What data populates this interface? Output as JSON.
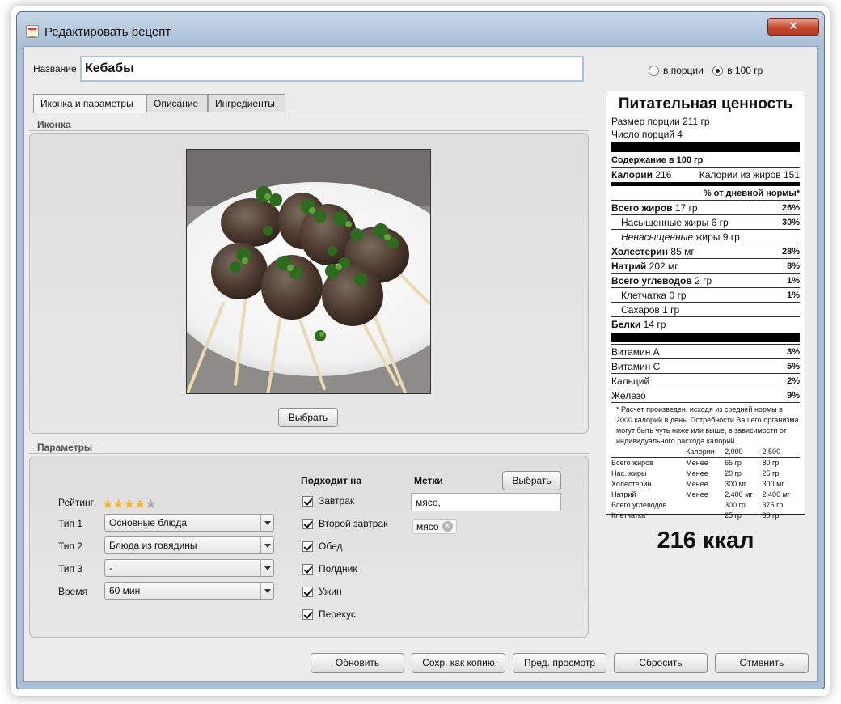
{
  "window": {
    "title": "Редактировать рецепт",
    "close_icon": "close-icon"
  },
  "name": {
    "label": "Название",
    "value": "Кебабы"
  },
  "portion_mode": {
    "options": [
      "в порции",
      "в 100 гр"
    ],
    "selected": "в 100 гр"
  },
  "tabs": [
    {
      "label": "Иконка и параметры",
      "active": true
    },
    {
      "label": "Описание",
      "active": false
    },
    {
      "label": "Ингредиенты",
      "active": false
    }
  ],
  "icon_section": {
    "title": "Иконка",
    "choose_label": "Выбрать"
  },
  "params": {
    "title": "Параметры",
    "rating_label": "Рейтинг",
    "rating": 4,
    "rating_max": 5,
    "type1_label": "Тип 1",
    "type1_value": "Основные блюда",
    "type2_label": "Тип 2",
    "type2_value": "Блюда из говядины",
    "type3_label": "Тип 3",
    "type3_value": "-",
    "time_label": "Время",
    "time_value": "60 мин"
  },
  "suitable": {
    "title": "Подходит на",
    "items": [
      {
        "label": "Завтрак",
        "checked": true
      },
      {
        "label": "Второй завтрак",
        "checked": true
      },
      {
        "label": "Обед",
        "checked": true
      },
      {
        "label": "Полдник",
        "checked": true
      },
      {
        "label": "Ужин",
        "checked": true
      },
      {
        "label": "Перекус",
        "checked": true
      }
    ]
  },
  "tags": {
    "title": "Метки",
    "choose_label": "Выбрать",
    "input_value": "мясо,",
    "chips": [
      "мясо"
    ]
  },
  "nutrition": {
    "title": "Питательная ценность",
    "serving_size": "Размер порции 211 гр",
    "servings": "Число порций 4",
    "content_per": "Содержание в 100 гр",
    "calories_label": "Калории",
    "calories_value": "216",
    "calories_fat": "Калории из жиров 151",
    "daily_header": "% от дневной нормы*",
    "rows": [
      {
        "label": "Всего жиров",
        "value": "17 гр",
        "pct": "26%",
        "bold": true,
        "indent": false,
        "italic": false
      },
      {
        "label": "Насыщенные жиры",
        "value": "6 гр",
        "pct": "30%",
        "bold": false,
        "indent": true,
        "italic": false
      },
      {
        "label": "Ненасыщенные",
        "value": "жиры 9 гр",
        "pct": "",
        "bold": false,
        "indent": true,
        "italic": true
      },
      {
        "label": "Холестерин",
        "value": "85 мг",
        "pct": "28%",
        "bold": true,
        "indent": false,
        "italic": false
      },
      {
        "label": "Натрий",
        "value": "202 мг",
        "pct": "8%",
        "bold": true,
        "indent": false,
        "italic": false
      },
      {
        "label": "Всего углеводов",
        "value": "2 гр",
        "pct": "1%",
        "bold": true,
        "indent": false,
        "italic": false
      },
      {
        "label": "Клетчатка",
        "value": "0 гр",
        "pct": "1%",
        "bold": false,
        "indent": true,
        "italic": false
      },
      {
        "label": "Сахаров",
        "value": "1 гр",
        "pct": "",
        "bold": false,
        "indent": true,
        "italic": false
      },
      {
        "label": "Белки",
        "value": "14 гр",
        "pct": "",
        "bold": true,
        "indent": false,
        "italic": false
      }
    ],
    "vitamins": [
      {
        "label": "Витамин A",
        "pct": "3%"
      },
      {
        "label": "Витамин C",
        "pct": "5%"
      },
      {
        "label": "Кальций",
        "pct": "2%"
      },
      {
        "label": "Железо",
        "pct": "9%"
      }
    ],
    "footnote": "* Расчет произведен, исходя из средней нормы в 2000 калорий в день. Потребности Вашего организма могут быть чуть ниже или выше, в зависимости от индивидуального расхода калорий.",
    "table_header": [
      "",
      "Калории",
      "2,000",
      "2,500"
    ],
    "table_rows": [
      [
        "Всего жиров",
        "Менее",
        "65 гр",
        "80 гр"
      ],
      [
        "Нас. жиры",
        "Менее",
        "20 гр",
        "25 гр"
      ],
      [
        "Холестерин",
        "Менее",
        "300 мг",
        "300 мг"
      ],
      [
        "Натрий",
        "Менее",
        "2,400 мг",
        "2,400 мг"
      ],
      [
        "Всего углеводов",
        "",
        "300 гр",
        "375 гр"
      ],
      [
        "Клетчатка",
        "",
        "25 гр",
        "30 гр"
      ]
    ],
    "kcal_total": "216 ккал"
  },
  "bottom_buttons": [
    "Обновить",
    "Сохр. как копию",
    "Пред. просмотр",
    "Сбросить",
    "Отменить"
  ]
}
